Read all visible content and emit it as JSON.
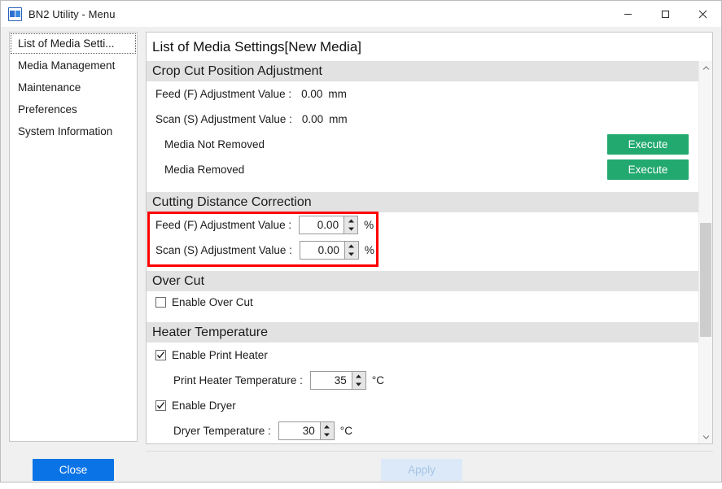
{
  "window": {
    "title": "BN2 Utility - Menu",
    "icon": "app-logo-icon",
    "controls": {
      "minimize": "minimize-icon",
      "maximize": "maximize-icon",
      "close": "close-icon"
    }
  },
  "sidebar": {
    "items": [
      {
        "label": "List of Media Setti...",
        "focused": true
      },
      {
        "label": "Media Management",
        "focused": false
      },
      {
        "label": "Maintenance",
        "focused": false
      },
      {
        "label": "Preferences",
        "focused": false
      },
      {
        "label": "System Information",
        "focused": false
      }
    ]
  },
  "panel": {
    "title": "List of Media Settings[New Media]",
    "sections": [
      {
        "header": "Crop Cut Position Adjustment",
        "rows": [
          {
            "label": "Feed (F) Adjustment Value :",
            "value": "0.00",
            "unit": "mm",
            "type": "static"
          },
          {
            "label": "Scan (S) Adjustment Value :",
            "value": "0.00",
            "unit": "mm",
            "type": "static"
          },
          {
            "label": "Media Not Removed",
            "button": "Execute",
            "type": "action"
          },
          {
            "label": "Media Removed",
            "button": "Execute",
            "type": "action"
          }
        ]
      },
      {
        "header": "Cutting Distance Correction",
        "highlighted": true,
        "rows": [
          {
            "label": "Feed (F) Adjustment Value :",
            "value": "0.00",
            "unit": "%",
            "type": "spinner"
          },
          {
            "label": "Scan (S) Adjustment Value :",
            "value": "0.00",
            "unit": "%",
            "type": "spinner"
          }
        ]
      },
      {
        "header": "Over Cut",
        "rows": [
          {
            "label": "Enable Over Cut",
            "checked": false,
            "type": "checkbox"
          }
        ]
      },
      {
        "header": "Heater Temperature",
        "rows": [
          {
            "label": "Enable Print Heater",
            "checked": true,
            "type": "checkbox"
          },
          {
            "label": "Print Heater Temperature :",
            "value": "35",
            "unit": "°C",
            "type": "spinner"
          },
          {
            "label": "Enable Dryer",
            "checked": true,
            "type": "checkbox"
          },
          {
            "label": "Dryer Temperature :",
            "value": "30",
            "unit": "°C",
            "type": "spinner"
          }
        ]
      }
    ]
  },
  "scrollbar": {
    "up_arrow": "chevron-up-icon",
    "down_arrow": "chevron-down-icon"
  },
  "footer": {
    "close_label": "Close",
    "apply_label": "Apply"
  },
  "colors": {
    "execute_green": "#22a96f",
    "close_blue": "#0a73e6",
    "apply_disabled": "#dbe9f8",
    "highlight_red": "#ff0000",
    "section_header_bg": "#e2e2e2"
  }
}
